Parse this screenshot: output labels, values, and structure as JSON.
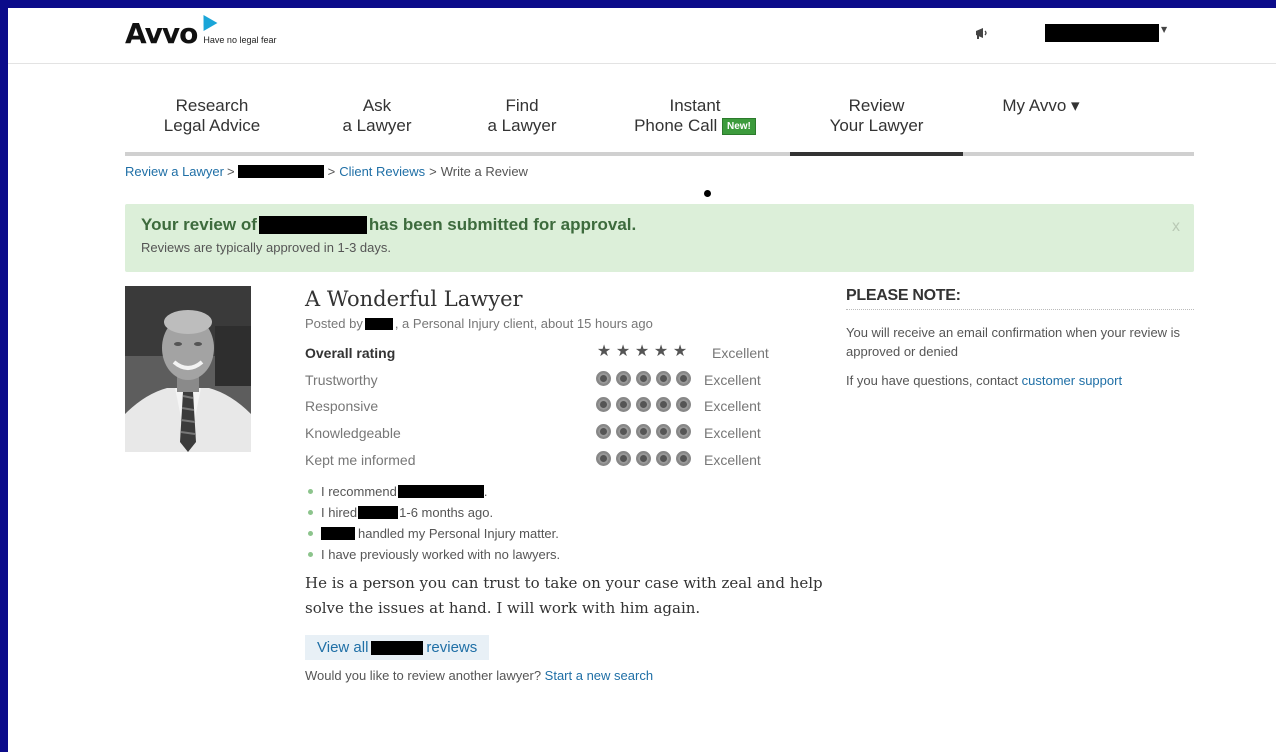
{
  "header": {
    "logo_text": "AVVO",
    "tagline": "Have no legal fear",
    "icons": [
      "megaphone-icon",
      "chevron-down-icon"
    ]
  },
  "nav": {
    "items": [
      {
        "line1": "Research",
        "line2": "Legal Advice"
      },
      {
        "line1": "Ask",
        "line2": "a Lawyer"
      },
      {
        "line1": "Find",
        "line2": "a Lawyer"
      },
      {
        "line1": "Instant",
        "line2": "Phone Call",
        "badge": "New!"
      },
      {
        "line1": "Review",
        "line2": "Your Lawyer",
        "active": true
      },
      {
        "line1": "",
        "line2": "My Avvo ▾"
      }
    ]
  },
  "breadcrumb": {
    "item1": "Review a Lawyer",
    "sep": ">",
    "item3": "Client Reviews",
    "item4": "Write a Review"
  },
  "alert": {
    "title_prefix": "Your review of",
    "title_suffix": "has been submitted for approval.",
    "subtitle": "Reviews are typically approved in 1-3 days.",
    "close": "x"
  },
  "review": {
    "title": "A Wonderful Lawyer",
    "posted_prefix": "Posted by",
    "posted_suffix": ", a Personal Injury client, about 15 hours ago",
    "overall_label": "Overall rating",
    "overall_value": "Excellent",
    "overall_stars": 5,
    "criteria": [
      {
        "label": "Trustworthy",
        "value": "Excellent",
        "score": 5
      },
      {
        "label": "Responsive",
        "value": "Excellent",
        "score": 5
      },
      {
        "label": "Knowledgeable",
        "value": "Excellent",
        "score": 5
      },
      {
        "label": "Kept me informed",
        "value": "Excellent",
        "score": 5
      }
    ],
    "facts": {
      "recommend": "I recommend",
      "recommend_end": ".",
      "hired_prefix": "I hired",
      "hired_suffix": "1-6 months ago.",
      "handled": "handled my Personal Injury matter.",
      "previous": "I have previously worked with no lawyers."
    },
    "body": "He is a person you can trust to take on your case with zeal and help solve the issues at hand. I will work with him again.",
    "view_all_prefix": "View all",
    "view_all_suffix": "reviews",
    "another_text": "Would you like to review another lawyer?",
    "another_link": "Start a new search"
  },
  "note": {
    "title": "PLEASE NOTE:",
    "p1": "You will receive an email confirmation when your review is approved or denied",
    "p2_text": "If you have questions, contact",
    "p2_link": "customer support"
  },
  "colors": {
    "frame_border": "#0b0b8a",
    "link": "#1f6fa6",
    "alert_bg": "#dcefd9",
    "alert_text": "#3d6b3d",
    "badge": "#3c9b3c"
  }
}
